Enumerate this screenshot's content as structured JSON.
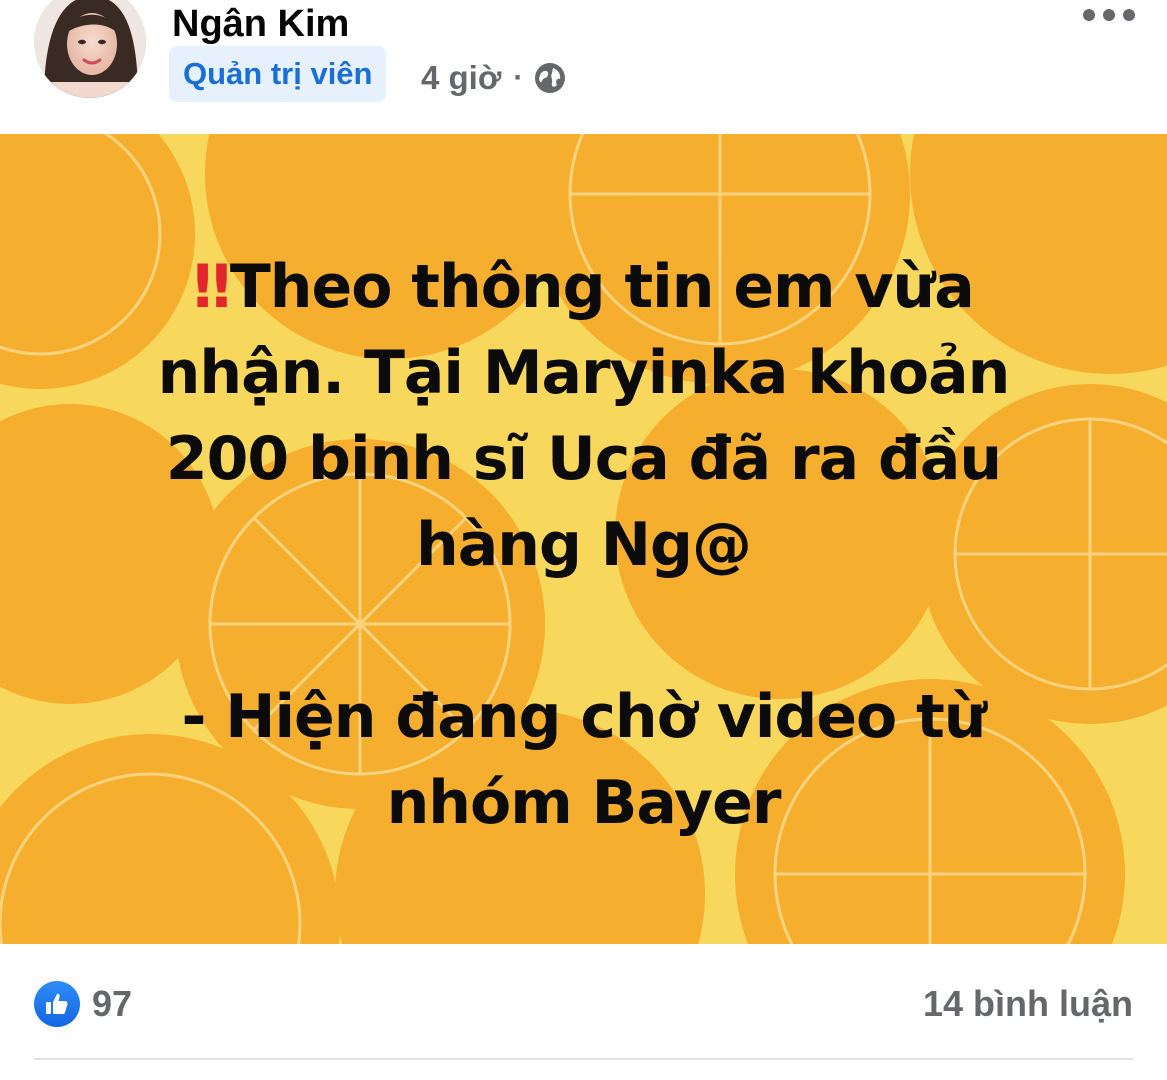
{
  "post": {
    "author": "Ngân Kim",
    "role_badge": "Quản trị viên",
    "timestamp": "4 giờ",
    "separator": "·",
    "privacy_icon": "globe-icon",
    "more_icon": "more-options-icon"
  },
  "card": {
    "prefix_emoji": "‼",
    "lines": [
      "Theo thông tin em vừa",
      "nhận. Tại Maryinka khoản",
      "200 binh sĩ Uca đã ra đầu",
      "hàng Ng@",
      "",
      "- Hiện đang chờ video từ",
      "nhóm Bayer"
    ],
    "colors": {
      "background": "#f7d85c",
      "orange": "#f5a623",
      "text": "#0b0b0b",
      "emoji": "#e3262c"
    }
  },
  "footer": {
    "like_icon": "like-thumb-icon",
    "reaction_count": "97",
    "comments": "14 bình luận"
  },
  "colors": {
    "badge_bg": "#e7f0fd",
    "badge_text": "#1a6ed8",
    "meta_text": "#65676b",
    "like_blue": "#1877f2"
  }
}
